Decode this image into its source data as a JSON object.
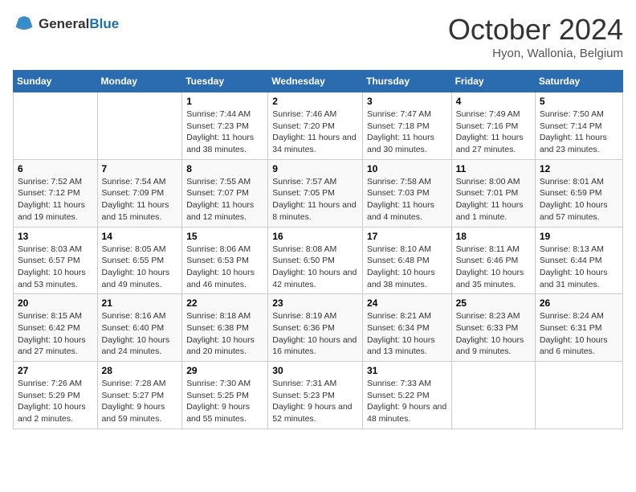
{
  "header": {
    "logo_general": "General",
    "logo_blue": "Blue",
    "month": "October 2024",
    "location": "Hyon, Wallonia, Belgium"
  },
  "weekdays": [
    "Sunday",
    "Monday",
    "Tuesday",
    "Wednesday",
    "Thursday",
    "Friday",
    "Saturday"
  ],
  "weeks": [
    [
      {
        "num": "",
        "info": ""
      },
      {
        "num": "",
        "info": ""
      },
      {
        "num": "1",
        "info": "Sunrise: 7:44 AM\nSunset: 7:23 PM\nDaylight: 11 hours and 38 minutes."
      },
      {
        "num": "2",
        "info": "Sunrise: 7:46 AM\nSunset: 7:20 PM\nDaylight: 11 hours and 34 minutes."
      },
      {
        "num": "3",
        "info": "Sunrise: 7:47 AM\nSunset: 7:18 PM\nDaylight: 11 hours and 30 minutes."
      },
      {
        "num": "4",
        "info": "Sunrise: 7:49 AM\nSunset: 7:16 PM\nDaylight: 11 hours and 27 minutes."
      },
      {
        "num": "5",
        "info": "Sunrise: 7:50 AM\nSunset: 7:14 PM\nDaylight: 11 hours and 23 minutes."
      }
    ],
    [
      {
        "num": "6",
        "info": "Sunrise: 7:52 AM\nSunset: 7:12 PM\nDaylight: 11 hours and 19 minutes."
      },
      {
        "num": "7",
        "info": "Sunrise: 7:54 AM\nSunset: 7:09 PM\nDaylight: 11 hours and 15 minutes."
      },
      {
        "num": "8",
        "info": "Sunrise: 7:55 AM\nSunset: 7:07 PM\nDaylight: 11 hours and 12 minutes."
      },
      {
        "num": "9",
        "info": "Sunrise: 7:57 AM\nSunset: 7:05 PM\nDaylight: 11 hours and 8 minutes."
      },
      {
        "num": "10",
        "info": "Sunrise: 7:58 AM\nSunset: 7:03 PM\nDaylight: 11 hours and 4 minutes."
      },
      {
        "num": "11",
        "info": "Sunrise: 8:00 AM\nSunset: 7:01 PM\nDaylight: 11 hours and 1 minute."
      },
      {
        "num": "12",
        "info": "Sunrise: 8:01 AM\nSunset: 6:59 PM\nDaylight: 10 hours and 57 minutes."
      }
    ],
    [
      {
        "num": "13",
        "info": "Sunrise: 8:03 AM\nSunset: 6:57 PM\nDaylight: 10 hours and 53 minutes."
      },
      {
        "num": "14",
        "info": "Sunrise: 8:05 AM\nSunset: 6:55 PM\nDaylight: 10 hours and 49 minutes."
      },
      {
        "num": "15",
        "info": "Sunrise: 8:06 AM\nSunset: 6:53 PM\nDaylight: 10 hours and 46 minutes."
      },
      {
        "num": "16",
        "info": "Sunrise: 8:08 AM\nSunset: 6:50 PM\nDaylight: 10 hours and 42 minutes."
      },
      {
        "num": "17",
        "info": "Sunrise: 8:10 AM\nSunset: 6:48 PM\nDaylight: 10 hours and 38 minutes."
      },
      {
        "num": "18",
        "info": "Sunrise: 8:11 AM\nSunset: 6:46 PM\nDaylight: 10 hours and 35 minutes."
      },
      {
        "num": "19",
        "info": "Sunrise: 8:13 AM\nSunset: 6:44 PM\nDaylight: 10 hours and 31 minutes."
      }
    ],
    [
      {
        "num": "20",
        "info": "Sunrise: 8:15 AM\nSunset: 6:42 PM\nDaylight: 10 hours and 27 minutes."
      },
      {
        "num": "21",
        "info": "Sunrise: 8:16 AM\nSunset: 6:40 PM\nDaylight: 10 hours and 24 minutes."
      },
      {
        "num": "22",
        "info": "Sunrise: 8:18 AM\nSunset: 6:38 PM\nDaylight: 10 hours and 20 minutes."
      },
      {
        "num": "23",
        "info": "Sunrise: 8:19 AM\nSunset: 6:36 PM\nDaylight: 10 hours and 16 minutes."
      },
      {
        "num": "24",
        "info": "Sunrise: 8:21 AM\nSunset: 6:34 PM\nDaylight: 10 hours and 13 minutes."
      },
      {
        "num": "25",
        "info": "Sunrise: 8:23 AM\nSunset: 6:33 PM\nDaylight: 10 hours and 9 minutes."
      },
      {
        "num": "26",
        "info": "Sunrise: 8:24 AM\nSunset: 6:31 PM\nDaylight: 10 hours and 6 minutes."
      }
    ],
    [
      {
        "num": "27",
        "info": "Sunrise: 7:26 AM\nSunset: 5:29 PM\nDaylight: 10 hours and 2 minutes."
      },
      {
        "num": "28",
        "info": "Sunrise: 7:28 AM\nSunset: 5:27 PM\nDaylight: 9 hours and 59 minutes."
      },
      {
        "num": "29",
        "info": "Sunrise: 7:30 AM\nSunset: 5:25 PM\nDaylight: 9 hours and 55 minutes."
      },
      {
        "num": "30",
        "info": "Sunrise: 7:31 AM\nSunset: 5:23 PM\nDaylight: 9 hours and 52 minutes."
      },
      {
        "num": "31",
        "info": "Sunrise: 7:33 AM\nSunset: 5:22 PM\nDaylight: 9 hours and 48 minutes."
      },
      {
        "num": "",
        "info": ""
      },
      {
        "num": "",
        "info": ""
      }
    ]
  ]
}
